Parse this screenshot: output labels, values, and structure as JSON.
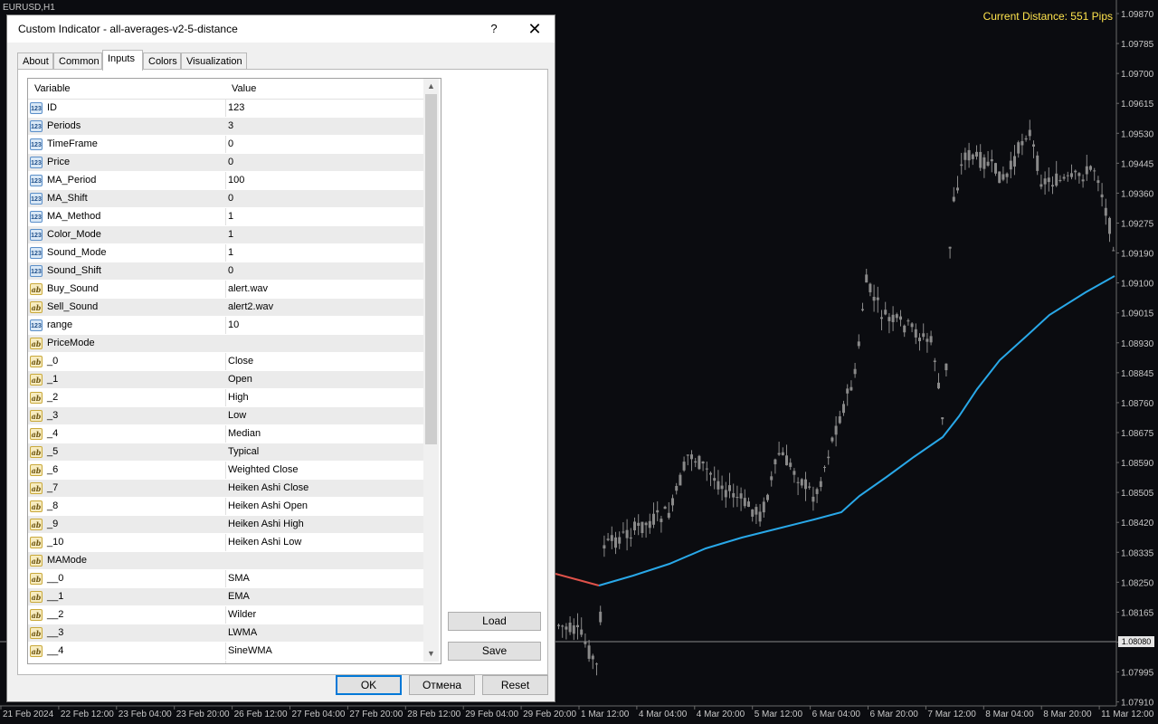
{
  "chart": {
    "symbol": "EURUSD,H1",
    "distance_text": "Current Distance: 551 Pips",
    "current_price": "1.08080",
    "price_labels": [
      "1.09870",
      "1.09785",
      "1.09700",
      "1.09615",
      "1.09530",
      "1.09445",
      "1.09360",
      "1.09275",
      "1.09190",
      "1.09100",
      "1.09015",
      "1.08930",
      "1.08845",
      "1.08760",
      "1.08675",
      "1.08590",
      "1.08505",
      "1.08420",
      "1.08335",
      "1.08250",
      "1.08165",
      "1.08080",
      "1.07995",
      "1.07910"
    ],
    "time_labels": [
      "21 Feb 2024",
      "22 Feb 12:00",
      "23 Feb 04:00",
      "23 Feb 20:00",
      "26 Feb 12:00",
      "27 Feb 04:00",
      "27 Feb 20:00",
      "28 Feb 12:00",
      "29 Feb 04:00",
      "29 Feb 20:00",
      "1 Mar 12:00",
      "4 Mar 04:00",
      "4 Mar 20:00",
      "5 Mar 12:00",
      "6 Mar 04:00",
      "6 Mar 20:00",
      "7 Mar 12:00",
      "8 Mar 04:00",
      "8 Mar 20:00",
      "11 Mar 12:00"
    ],
    "colors": {
      "bg": "#0b0c10",
      "candle": "#8a8a8a",
      "ma_up": "#29a8e8",
      "ma_down": "#e0524a",
      "text": "#c8c8c8",
      "distance": "#ffe44d"
    }
  },
  "dialog": {
    "title": "Custom Indicator - all-averages-v2-5-distance",
    "help": "?",
    "close": "✕",
    "tabs": [
      {
        "label": "About"
      },
      {
        "label": "Common"
      },
      {
        "label": "Inputs",
        "active": true
      },
      {
        "label": "Colors"
      },
      {
        "label": "Visualization"
      }
    ],
    "grid": {
      "col_variable": "Variable",
      "col_value": "Value",
      "rows": [
        {
          "type": "num",
          "name": "ID",
          "value": "123"
        },
        {
          "type": "num",
          "name": "Periods",
          "value": "3"
        },
        {
          "type": "num",
          "name": "TimeFrame",
          "value": "0"
        },
        {
          "type": "num",
          "name": "Price",
          "value": "0"
        },
        {
          "type": "num",
          "name": "MA_Period",
          "value": "100"
        },
        {
          "type": "num",
          "name": "MA_Shift",
          "value": "0"
        },
        {
          "type": "num",
          "name": "MA_Method",
          "value": "1"
        },
        {
          "type": "num",
          "name": "Color_Mode",
          "value": "1"
        },
        {
          "type": "num",
          "name": "Sound_Mode",
          "value": "1"
        },
        {
          "type": "num",
          "name": "Sound_Shift",
          "value": "0"
        },
        {
          "type": "str",
          "name": "Buy_Sound",
          "value": "alert.wav"
        },
        {
          "type": "str",
          "name": "Sell_Sound",
          "value": "alert2.wav"
        },
        {
          "type": "num",
          "name": "range",
          "value": "10"
        },
        {
          "type": "str",
          "name": "PriceMode",
          "value": ""
        },
        {
          "type": "str",
          "name": "_0",
          "value": "Close"
        },
        {
          "type": "str",
          "name": "_1",
          "value": "Open"
        },
        {
          "type": "str",
          "name": "_2",
          "value": "High"
        },
        {
          "type": "str",
          "name": "_3",
          "value": "Low"
        },
        {
          "type": "str",
          "name": "_4",
          "value": "Median"
        },
        {
          "type": "str",
          "name": "_5",
          "value": "Typical"
        },
        {
          "type": "str",
          "name": "_6",
          "value": "Weighted Close"
        },
        {
          "type": "str",
          "name": "_7",
          "value": "Heiken Ashi Close"
        },
        {
          "type": "str",
          "name": "_8",
          "value": "Heiken Ashi Open"
        },
        {
          "type": "str",
          "name": "_9",
          "value": "Heiken Ashi High"
        },
        {
          "type": "str",
          "name": "_10",
          "value": "Heiken Ashi Low"
        },
        {
          "type": "str",
          "name": "MAMode",
          "value": ""
        },
        {
          "type": "str",
          "name": "__0",
          "value": "SMA"
        },
        {
          "type": "str",
          "name": "__1",
          "value": "EMA"
        },
        {
          "type": "str",
          "name": "__2",
          "value": "Wilder"
        },
        {
          "type": "str",
          "name": "__3",
          "value": "LWMA"
        },
        {
          "type": "str",
          "name": "__4",
          "value": "SineWMA"
        }
      ]
    },
    "icon_text": {
      "num": "123",
      "str": "ab"
    },
    "buttons": {
      "load": "Load",
      "save": "Save",
      "ok": "OK",
      "cancel": "Отмена",
      "reset": "Reset"
    }
  }
}
